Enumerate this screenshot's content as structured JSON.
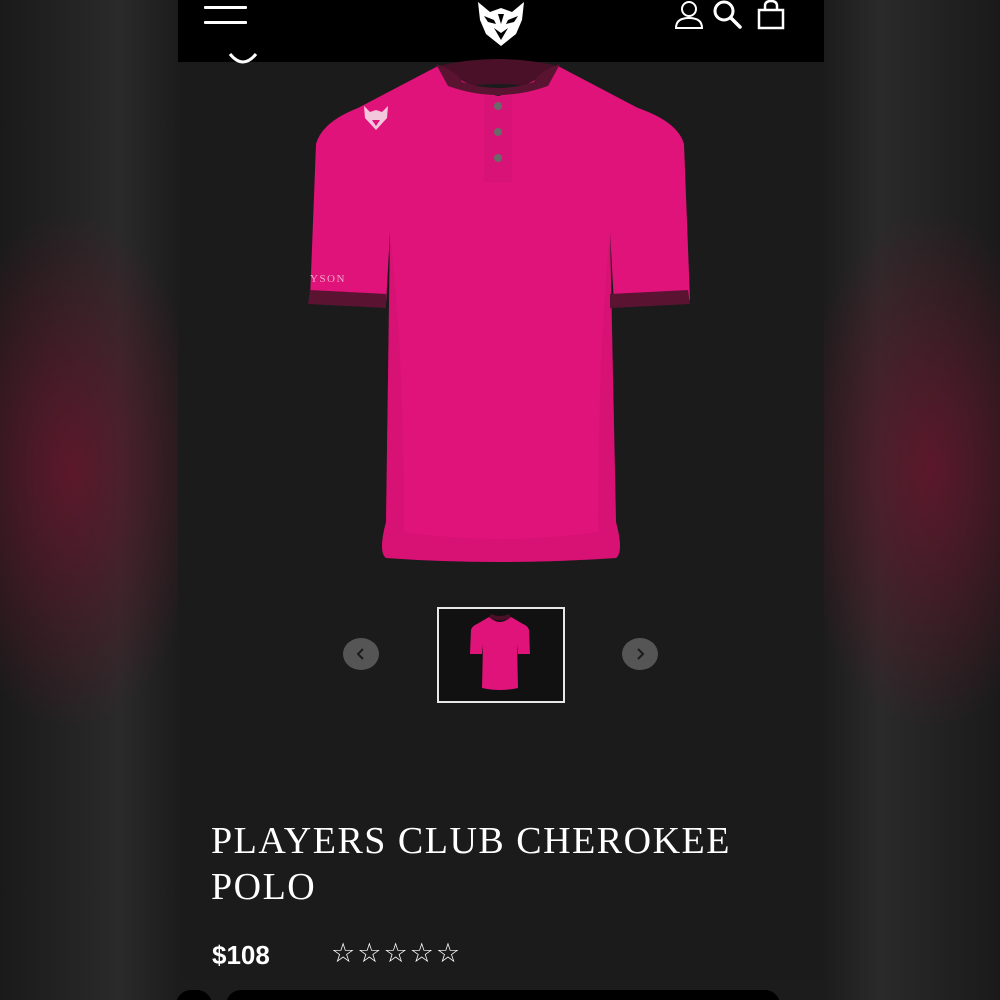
{
  "header": {
    "menu_icon": "hamburger-menu-icon",
    "logo_icon": "wolf-logo-icon",
    "account_icon": "person-icon",
    "search_icon": "search-icon",
    "cart_icon": "shopping-bag-icon"
  },
  "product": {
    "image": {
      "color": "#e0137a",
      "sleeve_text": "YSON"
    },
    "gallery": {
      "prev_icon": "chevron-left-icon",
      "next_icon": "chevron-right-icon"
    },
    "title": "PLAYERS CLUB CHEROKEE POLO",
    "price": "$108",
    "rating": {
      "stars": 0,
      "max": 5,
      "star_glyph": "☆"
    }
  },
  "colors": {
    "page_bg": "#1b1b1b",
    "header_bg": "#000000",
    "text": "#ffffff",
    "accent_pink": "#e0137a"
  }
}
